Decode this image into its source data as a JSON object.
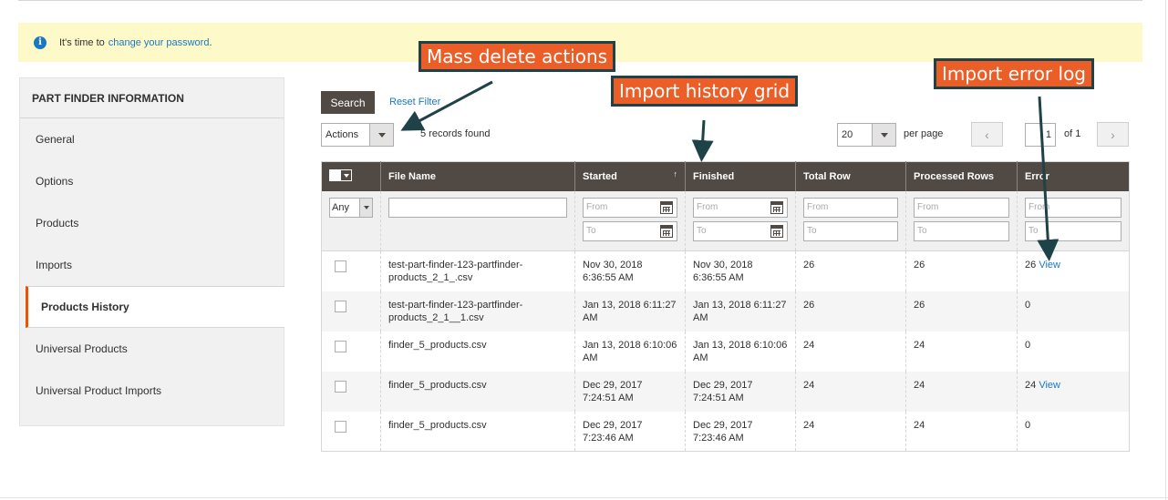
{
  "notice": {
    "text": "It's time to",
    "link": "change your password",
    "suffix": "."
  },
  "sidebar": {
    "title": "PART FINDER INFORMATION",
    "items": [
      {
        "label": "General"
      },
      {
        "label": "Options"
      },
      {
        "label": "Products"
      },
      {
        "label": "Imports"
      },
      {
        "label": "Products History",
        "active": true
      },
      {
        "label": "Universal Products"
      },
      {
        "label": "Universal Product Imports"
      }
    ]
  },
  "toolbar": {
    "search_label": "Search",
    "reset_label": "Reset Filter",
    "actions_value": "Actions",
    "records_text": "5 records found",
    "per_page_value": "20",
    "per_page_label": "per page",
    "page_value": "1",
    "page_of": "of 1"
  },
  "grid": {
    "columns": [
      "File Name",
      "Started",
      "Finished",
      "Total Row",
      "Processed Rows",
      "Error"
    ],
    "filter_any": "Any",
    "placeholder_from": "From",
    "placeholder_to": "To",
    "rows": [
      {
        "file": "test-part-finder-123-partfinder-products_2_1_.csv",
        "started": "Nov 30, 2018 6:36:55 AM",
        "finished": "Nov 30, 2018 6:36:55 AM",
        "total": "26",
        "processed": "26",
        "error": "26",
        "view": "View"
      },
      {
        "file": "test-part-finder-123-partfinder-products_2_1__1.csv",
        "started": "Jan 13, 2018 6:11:27 AM",
        "finished": "Jan 13, 2018 6:11:27 AM",
        "total": "26",
        "processed": "26",
        "error": "0",
        "view": ""
      },
      {
        "file": "finder_5_products.csv",
        "started": "Jan 13, 2018 6:10:06 AM",
        "finished": "Jan 13, 2018 6:10:06 AM",
        "total": "24",
        "processed": "24",
        "error": "0",
        "view": ""
      },
      {
        "file": "finder_5_products.csv",
        "started": "Dec 29, 2017 7:24:51 AM",
        "finished": "Dec 29, 2017 7:24:51 AM",
        "total": "24",
        "processed": "24",
        "error": "24",
        "view": "View"
      },
      {
        "file": "finder_5_products.csv",
        "started": "Dec 29, 2017 7:23:46 AM",
        "finished": "Dec 29, 2017 7:23:46 AM",
        "total": "24",
        "processed": "24",
        "error": "0",
        "view": ""
      }
    ]
  },
  "callouts": {
    "mass_delete": "Mass delete actions",
    "history_grid": "Import history grid",
    "error_log": "Import error log"
  },
  "colors": {
    "accent": "#eb5202",
    "header_bg": "#514943",
    "link": "#1979c3",
    "notice_bg": "#fdf9c8",
    "callout_bg": "#eb5e28",
    "callout_border": "#1e4248"
  }
}
